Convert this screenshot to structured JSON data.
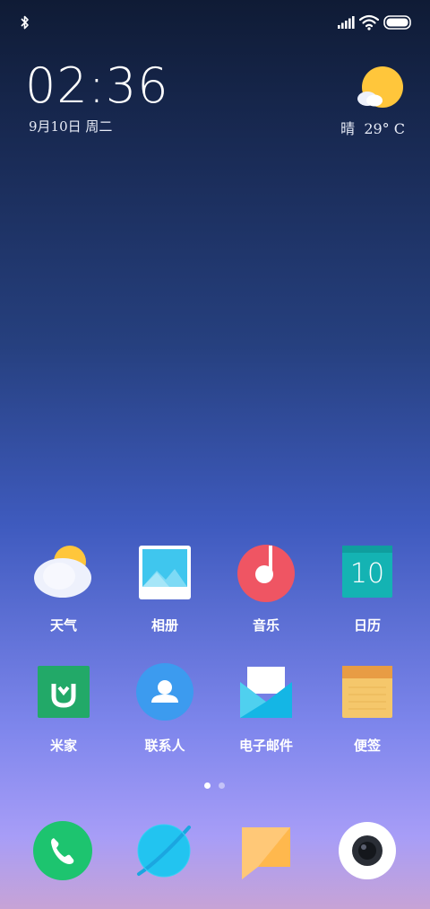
{
  "status_bar": {
    "icons": [
      "bluetooth-icon",
      "signal-icon",
      "wifi-icon",
      "battery-icon"
    ]
  },
  "clock": {
    "time": "02:36",
    "date": "9月10日 周二"
  },
  "weather": {
    "condition": "晴",
    "temperature": "29° C",
    "icon": "sunny-weather-icon"
  },
  "apps": [
    {
      "label": "天气",
      "icon": "weather-app-icon"
    },
    {
      "label": "相册",
      "icon": "gallery-app-icon"
    },
    {
      "label": "音乐",
      "icon": "music-app-icon"
    },
    {
      "label": "日历",
      "icon": "calendar-app-icon",
      "badge": "10"
    },
    {
      "label": "米家",
      "icon": "mijia-app-icon"
    },
    {
      "label": "联系人",
      "icon": "contacts-app-icon"
    },
    {
      "label": "电子邮件",
      "icon": "email-app-icon"
    },
    {
      "label": "便签",
      "icon": "notes-app-icon"
    }
  ],
  "page_indicator": {
    "pages": 2,
    "active": 1
  },
  "dock": [
    {
      "icon": "phone-app-icon"
    },
    {
      "icon": "browser-app-icon"
    },
    {
      "icon": "messages-app-icon"
    },
    {
      "icon": "camera-app-icon"
    }
  ],
  "colors": {
    "phone": "#1dc46f",
    "browser": "#22c4f0",
    "messages": "#ffb84d",
    "music": "#ef5563",
    "calendar": "#14b3b3",
    "mijia": "#22a968",
    "contacts": "#3c9bef",
    "notes": "#f5c76b",
    "sun": "#ffc63b"
  }
}
